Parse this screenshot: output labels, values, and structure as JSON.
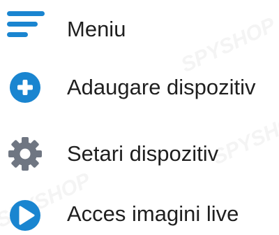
{
  "menu": {
    "title": "Meniu",
    "items": [
      {
        "label": "Adaugare dispozitiv",
        "icon": "add-circle-icon"
      },
      {
        "label": "Setari dispozitiv",
        "icon": "gear-icon"
      },
      {
        "label": "Acces imagini live",
        "icon": "play-circle-icon"
      }
    ]
  },
  "watermark": "SPYSHOP",
  "colors": {
    "blue": "#1a85d0",
    "gray": "#6f7682",
    "text": "#1f1f1f"
  }
}
